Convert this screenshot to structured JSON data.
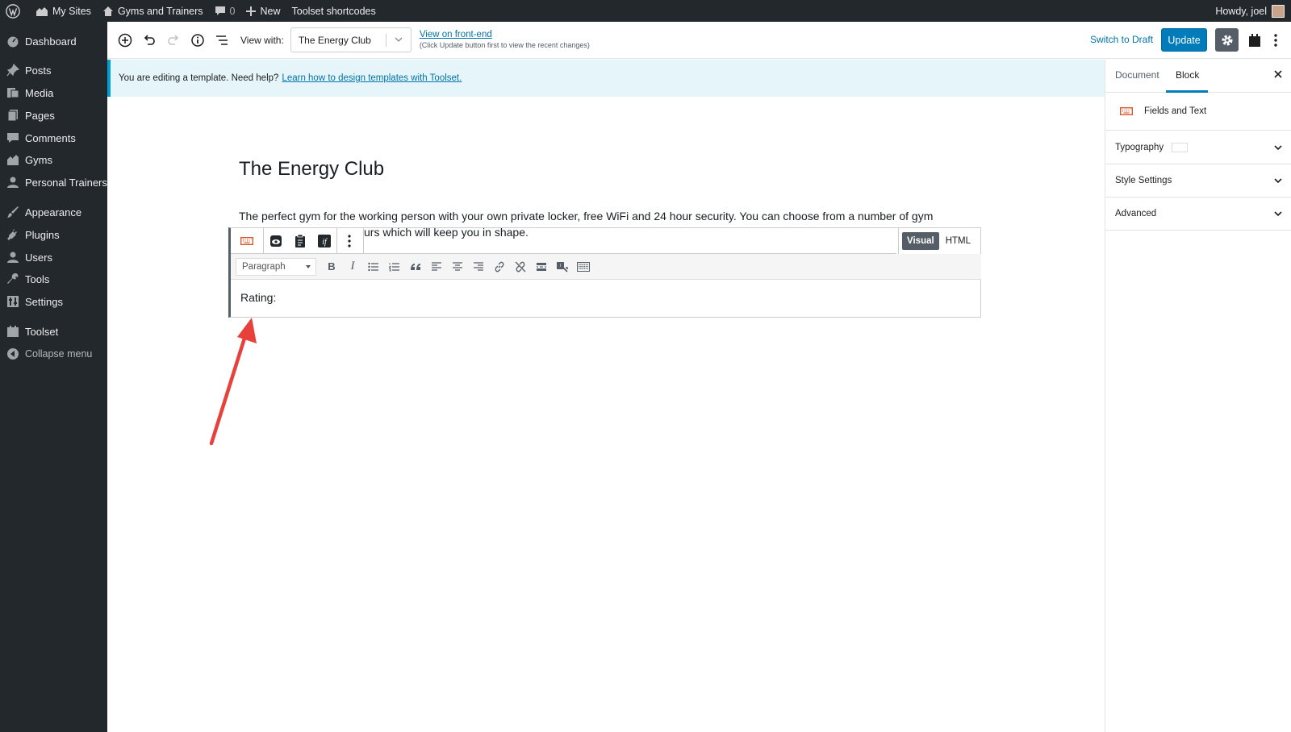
{
  "adminbar": {
    "my_sites": "My Sites",
    "site_name": "Gyms and Trainers",
    "comments_count": "0",
    "new_label": "New",
    "toolset_shortcodes": "Toolset shortcodes",
    "howdy": "Howdy, joel"
  },
  "sidebar": {
    "items": [
      {
        "label": "Dashboard",
        "icon": "dashboard-icon"
      },
      {
        "label": "Posts",
        "icon": "pin-icon"
      },
      {
        "label": "Media",
        "icon": "media-icon"
      },
      {
        "label": "Pages",
        "icon": "pages-icon"
      },
      {
        "label": "Comments",
        "icon": "comment-icon"
      },
      {
        "label": "Gyms",
        "icon": "gyms-icon"
      },
      {
        "label": "Personal Trainers",
        "icon": "user-icon"
      },
      {
        "label": "Appearance",
        "icon": "brush-icon"
      },
      {
        "label": "Plugins",
        "icon": "plug-icon"
      },
      {
        "label": "Users",
        "icon": "users-icon"
      },
      {
        "label": "Tools",
        "icon": "wrench-icon"
      },
      {
        "label": "Settings",
        "icon": "settings-icon"
      },
      {
        "label": "Toolset",
        "icon": "toolset-icon"
      },
      {
        "label": "Collapse menu",
        "icon": "collapse-icon"
      }
    ]
  },
  "header": {
    "view_with_label": "View with:",
    "view_with_value": "The Energy Club",
    "front_end_link": "View on front-end",
    "front_end_note": "(Click Update button first to view the recent changes)",
    "switch_to_draft": "Switch to Draft",
    "update": "Update"
  },
  "notice": {
    "text": "You are editing a template. Need help?",
    "link": "Learn how to design templates with Toolset."
  },
  "content": {
    "title": "The Energy Club",
    "paragraph": "The perfect gym for the working person with your own private locker, free WiFi and 24 hour security. You can choose from a number of gym",
    "paragraph_cont": "urs which will keep you in shape.",
    "format_select": "Paragraph",
    "mode_visual": "Visual",
    "mode_html": "HTML",
    "rating_label": "Rating:"
  },
  "right_panel": {
    "tab_document": "Document",
    "tab_block": "Block",
    "block_name": "Fields and Text",
    "panels": [
      "Typography",
      "Style Settings",
      "Advanced"
    ]
  },
  "colors": {
    "admin_dark": "#23282d",
    "accent_blue": "#007cba",
    "notice_bg": "#e5f5fa",
    "arrow_red": "#e8403a"
  }
}
